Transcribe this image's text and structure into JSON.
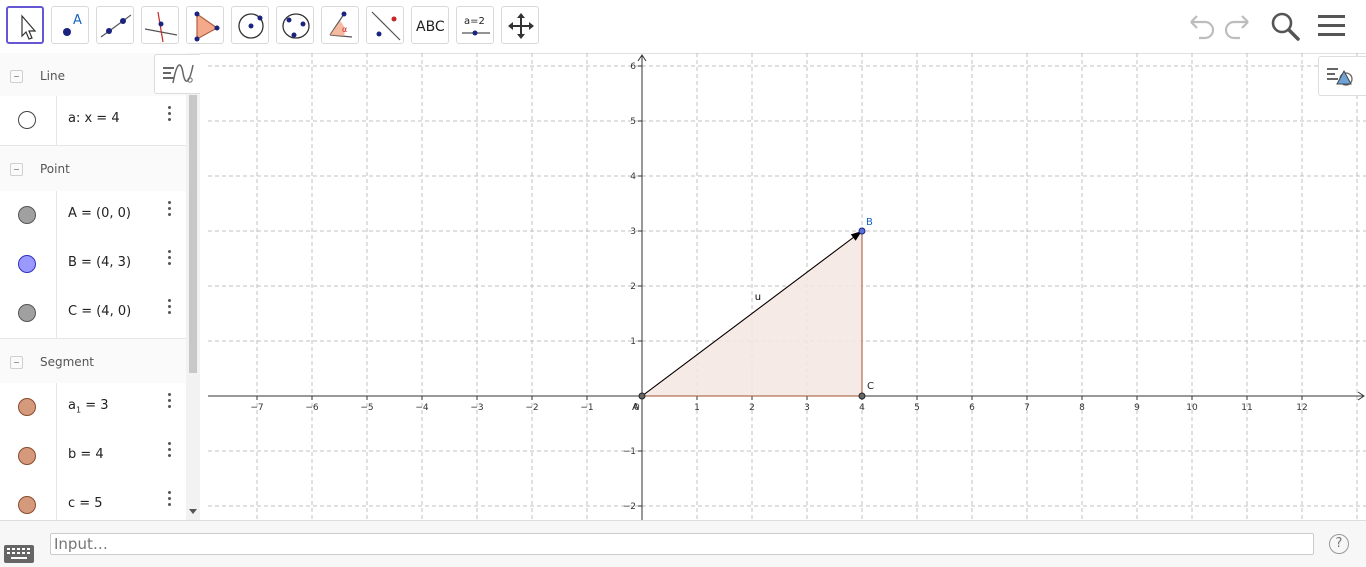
{
  "toolbar": {
    "tools": [
      {
        "name": "move-tool",
        "active": true
      },
      {
        "name": "point-tool"
      },
      {
        "name": "line-tool"
      },
      {
        "name": "perpendicular-line-tool"
      },
      {
        "name": "polygon-tool"
      },
      {
        "name": "circle-center-point-tool"
      },
      {
        "name": "circle-three-points-tool"
      },
      {
        "name": "angle-tool"
      },
      {
        "name": "reflect-tool"
      },
      {
        "name": "text-tool",
        "label": "ABC"
      },
      {
        "name": "slider-tool",
        "label": "a=2"
      },
      {
        "name": "move-graphics-tool"
      }
    ],
    "point_tool_label": "A"
  },
  "algebra": {
    "groups": [
      {
        "label": "Line",
        "items": [
          {
            "text": "a: x = 4",
            "color": "#ffffff"
          }
        ]
      },
      {
        "label": "Point",
        "items": [
          {
            "text": "A = (0, 0)",
            "color": "#a0a0a0"
          },
          {
            "text": "B = (4, 3)",
            "color": "#9999ff"
          },
          {
            "text": "C = (4, 0)",
            "color": "#a0a0a0"
          }
        ]
      },
      {
        "label": "Segment",
        "items": [
          {
            "text": "a",
            "sub": "1",
            "rest": " = 3",
            "color": "#d59a7c"
          },
          {
            "text": "b = 4",
            "color": "#d59a7c"
          },
          {
            "text": "c = 5",
            "color": "#d59a7c"
          }
        ]
      }
    ]
  },
  "graphics": {
    "x_ticks": [
      -7,
      -6,
      -5,
      -4,
      -3,
      -2,
      -1,
      1,
      2,
      3,
      4,
      5,
      6,
      7,
      8,
      9,
      10,
      11,
      12
    ],
    "y_ticks": [
      6,
      5,
      4,
      3,
      2,
      1,
      -1,
      -2
    ],
    "origin_label": "0",
    "points": [
      {
        "label": "A",
        "x": 0,
        "y": 0
      },
      {
        "label": "B",
        "x": 4,
        "y": 3
      },
      {
        "label": "C",
        "x": 4,
        "y": 0
      }
    ],
    "vector_label": "u",
    "triangle_fill": "#f3e6e2",
    "segment_color": "#a0522d",
    "point_color": "#444444",
    "b_color": "#1565c0"
  },
  "input": {
    "placeholder": "Input…",
    "help": "?"
  }
}
